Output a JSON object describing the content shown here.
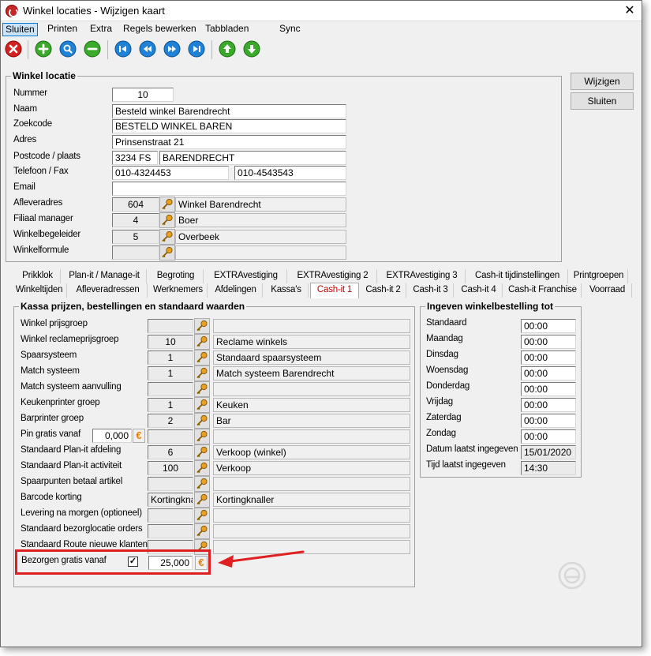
{
  "window": {
    "title": "Winkel locaties - Wijzigen kaart"
  },
  "menu": [
    "Sluiten",
    "Printen",
    "Extra",
    "Regels bewerken",
    "Tabbladen",
    "Sync"
  ],
  "toolbar": {
    "icons": [
      "close-red-icon",
      "add-green-icon",
      "search-blue-icon",
      "remove-green-icon",
      "first-record-icon",
      "previous-record-icon",
      "next-record-icon",
      "last-record-icon",
      "up-icon",
      "down-icon"
    ]
  },
  "location": {
    "group_title": "Winkel locatie",
    "nummer": {
      "label": "Nummer",
      "value": "10"
    },
    "naam": {
      "label": "Naam",
      "value": "Besteld winkel Barendrecht"
    },
    "zoekcode": {
      "label": "Zoekcode",
      "value": "BESTELD WINKEL BAREN"
    },
    "adres": {
      "label": "Adres",
      "value": "Prinsenstraat 21"
    },
    "postcode": {
      "label": "Postcode / plaats",
      "value": "3234 FS",
      "plaats": "BARENDRECHT"
    },
    "telefoon": {
      "label": "Telefoon / Fax",
      "value": "010-4324453",
      "fax": "010-4543543"
    },
    "email": {
      "label": "Email",
      "value": ""
    },
    "afleveradres": {
      "label": "Afleveradres",
      "code": "604",
      "name": "Winkel Barendrecht"
    },
    "filiaal": {
      "label": "Filiaal manager",
      "code": "4",
      "name": "Boer"
    },
    "begeleider": {
      "label": "Winkelbegeleider",
      "code": "5",
      "name": "Overbeek"
    },
    "formule": {
      "label": "Winkelformule",
      "code": "",
      "name": ""
    }
  },
  "buttons": {
    "wijzigen": "Wijzigen",
    "sluiten": "Sluiten"
  },
  "tabs_row1": [
    "Prikklok",
    "Plan-it / Manage-it",
    "Begroting",
    "EXTRAvestiging",
    "EXTRAvestiging 2",
    "EXTRAvestiging 3",
    "Cash-it tijdinstellingen",
    "Printgroepen"
  ],
  "tabs_row2": [
    "Winkeltijden",
    "Afleveradressen",
    "Werknemers",
    "Afdelingen",
    "Kassa's",
    "Cash-it 1",
    "Cash-it 2",
    "Cash-it 3",
    "Cash-it 4",
    "Cash-it Franchise",
    "Voorraad"
  ],
  "kassa": {
    "group_title": "Kassa prijzen, bestellingen en standaard waarden",
    "rows": [
      {
        "label": "Winkel prijsgroep",
        "code": "",
        "name": ""
      },
      {
        "label": "Winkel reclameprijsgroep",
        "code": "10",
        "name": "Reclame winkels"
      },
      {
        "label": "Spaarsysteem",
        "code": "1",
        "name": "Standaard spaarsysteem"
      },
      {
        "label": "Match systeem",
        "code": "1",
        "name": "Match systeem Barendrecht"
      },
      {
        "label": "Match systeem aanvulling",
        "code": "",
        "name": ""
      },
      {
        "label": "Keukenprinter groep",
        "code": "1",
        "name": "Keuken"
      },
      {
        "label": "Barprinter groep",
        "code": "2",
        "name": "Bar"
      },
      {
        "label": "Pin gratis vanaf",
        "code": "",
        "name": "",
        "amount": "0,000"
      },
      {
        "label": "Standaard Plan-it afdeling",
        "code": "6",
        "name": "Verkoop (winkel)"
      },
      {
        "label": "Standaard Plan-it activiteit",
        "code": "100",
        "name": "Verkoop"
      },
      {
        "label": "Spaarpunten betaal artikel",
        "code": "",
        "name": ""
      },
      {
        "label": "Barcode korting",
        "code": "Kortingknall",
        "name": "Kortingknaller"
      },
      {
        "label": "Levering na morgen (optioneel)",
        "code": "",
        "name": ""
      },
      {
        "label": "Standaard bezorglocatie orders",
        "code": "",
        "name": ""
      },
      {
        "label": "Standaard Route nieuwe klanten",
        "code": "",
        "name": ""
      }
    ],
    "bezorgen": {
      "label": "Bezorgen gratis vanaf",
      "checked": "✓",
      "amount": "25,000"
    }
  },
  "ingeven": {
    "group_title": "Ingeven winkelbestelling tot",
    "rows": [
      {
        "label": "Standaard",
        "value": "00:00"
      },
      {
        "label": "Maandag",
        "value": "00:00"
      },
      {
        "label": "Dinsdag",
        "value": "00:00"
      },
      {
        "label": "Woensdag",
        "value": "00:00"
      },
      {
        "label": "Donderdag",
        "value": "00:00"
      },
      {
        "label": "Vrijdag",
        "value": "00:00"
      },
      {
        "label": "Zaterdag",
        "value": "00:00"
      },
      {
        "label": "Zondag",
        "value": "00:00"
      },
      {
        "label": "Datum laatst ingegeven",
        "value": "15/01/2020"
      },
      {
        "label": "Tijd laatst ingegeven",
        "value": "14:30"
      }
    ]
  },
  "currency_symbol": "€",
  "colors": {
    "highlight_box": "#e02020",
    "active_tab": "#c00000",
    "euro": "#e67e00"
  }
}
